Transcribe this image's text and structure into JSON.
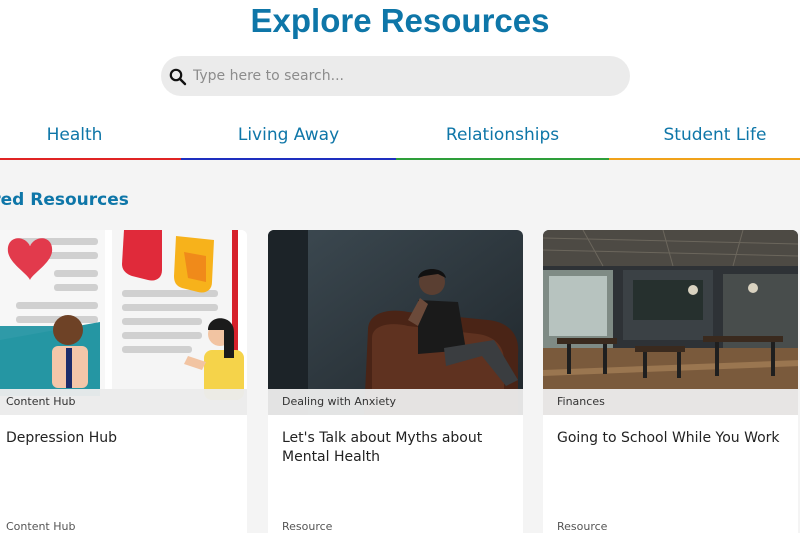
{
  "header": {
    "title": "Explore Resources"
  },
  "search": {
    "placeholder": "Type here to search..."
  },
  "tabs": [
    {
      "label": "Health",
      "color": "#e02424"
    },
    {
      "label": "Living Away",
      "color": "#1e2fbf"
    },
    {
      "label": "Relationships",
      "color": "#2e9e3a"
    },
    {
      "label": "Student Life",
      "color": "#f0a21a"
    }
  ],
  "featured": {
    "title": "tured Resources",
    "cards": [
      {
        "tag": "Content Hub",
        "title": "Depression Hub",
        "type": "Content Hub",
        "image": "illustration"
      },
      {
        "tag": "Dealing with Anxiety",
        "title": "Let's Talk about Myths about Mental Health",
        "type": "Resource",
        "image": "man-on-sofa-photo"
      },
      {
        "tag": "Finances",
        "title": "Going to School While You Work",
        "type": "Resource",
        "image": "cafe-interior-photo"
      }
    ]
  },
  "colors": {
    "accent": "#0e76a8"
  }
}
